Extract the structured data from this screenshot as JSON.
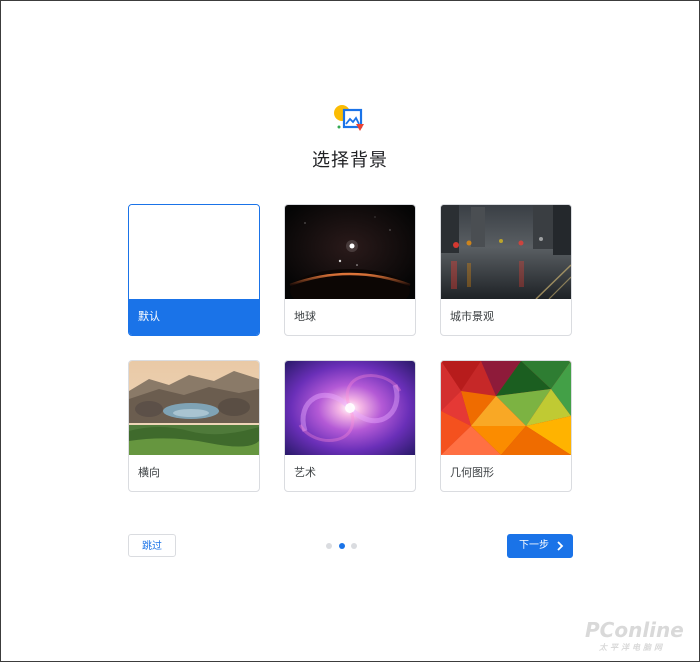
{
  "dialog": {
    "title": "选择背景",
    "logo_icon": "background-image-icon"
  },
  "cards": [
    {
      "label": "默认",
      "selected": true,
      "thumb": "blank"
    },
    {
      "label": "地球",
      "selected": false,
      "thumb": "earth-horizon-image"
    },
    {
      "label": "城市景观",
      "selected": false,
      "thumb": "city-street-rain-image"
    },
    {
      "label": "横向",
      "selected": false,
      "thumb": "rocky-coast-landscape-image"
    },
    {
      "label": "艺术",
      "selected": false,
      "thumb": "purple-galaxy-art-image"
    },
    {
      "label": "几何图形",
      "selected": false,
      "thumb": "colorful-polygon-geometry-image"
    }
  ],
  "footer": {
    "skip_label": "跳过",
    "next_label": "下一步",
    "next_icon": "chevron-right-icon",
    "pagination": {
      "total": 3,
      "current": 2
    }
  },
  "colors": {
    "accent": "#1a73e8",
    "border": "#dadce0",
    "dot_inactive": "#dadce0",
    "title_text": "#202124"
  },
  "watermark": {
    "main": "PConline",
    "sub": "太平洋电脑网"
  }
}
